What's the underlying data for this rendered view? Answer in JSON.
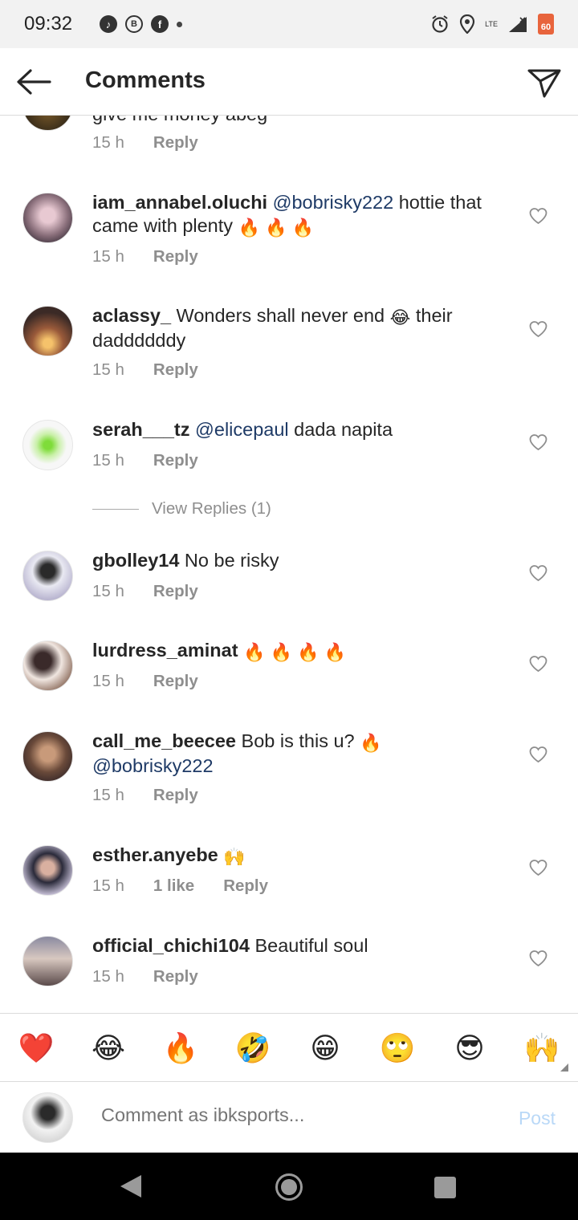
{
  "status_bar": {
    "time": "09:32",
    "notif_icons": [
      "tiktok-icon",
      "b-icon",
      "facebook-icon"
    ],
    "network": "LTE",
    "battery": "60"
  },
  "header": {
    "title": "Comments"
  },
  "partial_comment": {
    "text": "give me money abeg",
    "time": "15 h",
    "reply": "Reply"
  },
  "comments": [
    {
      "username": "iam_annabel.oluchi",
      "mention": "@bobrisky222",
      "text": " hottie that came with plenty ",
      "emojis": "🔥 🔥 🔥",
      "time": "15 h",
      "reply": "Reply"
    },
    {
      "username": "aclassy_",
      "text": " Wonders shall never end ",
      "emoji_mid": "😂",
      "text2": " their daddddddy",
      "time": "15 h",
      "reply": "Reply"
    },
    {
      "username": "serah___tz",
      "mention": "@elicepaul",
      "text": " dada napita",
      "time": "15 h",
      "reply": "Reply"
    },
    {
      "username": "gbolley14",
      "text": " No be risky",
      "time": "15 h",
      "reply": "Reply"
    },
    {
      "username": "lurdress_aminat",
      "emojis": "🔥 🔥 🔥 🔥",
      "time": "15 h",
      "reply": "Reply"
    },
    {
      "username": "call_me_beecee",
      "text": " Bob is this u? ",
      "emojis": "🔥",
      "mention": "@bobrisky222",
      "time": "15 h",
      "reply": "Reply"
    },
    {
      "username": "esther.anyebe",
      "emojis": "🙌",
      "time": "15 h",
      "likes": "1 like",
      "reply": "Reply"
    },
    {
      "username": "official_chichi104",
      "text": " Beautiful soul",
      "time": "15 h",
      "reply": "Reply"
    }
  ],
  "view_replies": "View Replies (1)",
  "emoji_bar": [
    "❤️",
    "😂",
    "🔥",
    "🤣",
    "😁",
    "🙄",
    "😎",
    "🙌"
  ],
  "composer": {
    "placeholder": "Comment as ibksports...",
    "post": "Post"
  }
}
